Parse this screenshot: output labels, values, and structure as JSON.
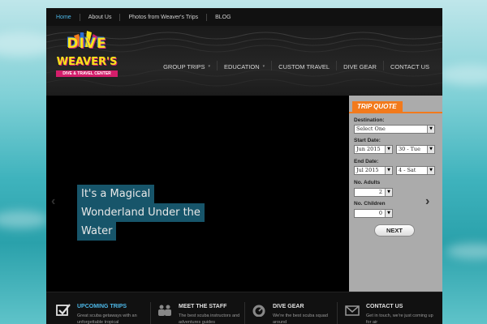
{
  "topbar": {
    "links": [
      "Home",
      "About Us",
      "Photos from Weaver's Trips",
      "BLOG"
    ]
  },
  "logo": {
    "line1": "DIVE",
    "line2": "WEAVER'S",
    "line3": "DIVE & TRAVEL CENTER"
  },
  "nav": {
    "items": [
      "GROUP TRIPS",
      "EDUCATION",
      "CUSTOM TRAVEL",
      "DIVE GEAR",
      "CONTACT US"
    ]
  },
  "slider": {
    "caption_lines": [
      "It's a Magical",
      "Wonderland Under the",
      "Water"
    ],
    "prev_arrow": "‹",
    "next_arrow": "›"
  },
  "quote": {
    "title": "TRIP QUOTE",
    "destination_label": "Destination:",
    "destination_value": "Select One",
    "start_label": "Start Date:",
    "start_month": "Jun 2015",
    "start_day": "30 - Tue",
    "end_label": "End Date:",
    "end_month": "Jul 2015",
    "end_day": "4 - Sat",
    "adults_label": "No. Adults",
    "adults_value": "2",
    "children_label": "No. Children",
    "children_value": "0",
    "next_label": "NEXT"
  },
  "features": [
    {
      "title": "UPCOMING TRIPS",
      "desc": "Great scuba getaways with an unforgettable tropical",
      "icon": "checkbox-icon"
    },
    {
      "title": "MEET THE STAFF",
      "desc": "The best scuba instructors and adventures guides",
      "icon": "people-icon"
    },
    {
      "title": "DIVE GEAR",
      "desc": "We're the best scuba squad around",
      "icon": "gauge-icon"
    },
    {
      "title": "CONTACT US",
      "desc": "Get in touch, we're just coming up for air",
      "icon": "envelope-icon"
    }
  ],
  "colors": {
    "accent_blue": "#4db8e8",
    "quote_orange": "#f27a1c",
    "caption_bg": "#17556a",
    "logo_yellow": "#f7e31a",
    "logo_pink": "#d41e6b"
  }
}
